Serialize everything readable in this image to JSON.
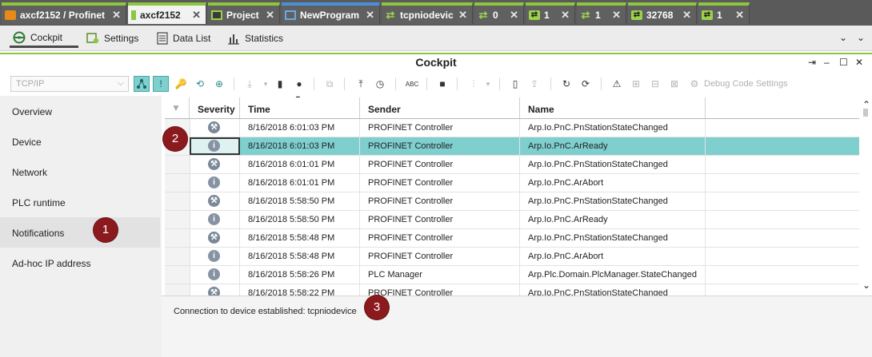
{
  "tabs": [
    {
      "label": "axcf2152 / Profinet",
      "icon": "device-orange-icon",
      "active": false
    },
    {
      "label": "axcf2152",
      "icon": "plc-green-icon",
      "active": true
    },
    {
      "label": "Project",
      "icon": "project-icon",
      "active": false
    },
    {
      "label": "NewProgram",
      "icon": "program-icon",
      "active": false
    },
    {
      "label": "tcpniodevice",
      "icon": "swap-arrows-icon",
      "active": false
    },
    {
      "label": "0",
      "icon": "swap-arrows-icon",
      "active": false
    },
    {
      "label": "1",
      "icon": "swap-box-icon",
      "active": false
    },
    {
      "label": "1",
      "icon": "swap-arrows-icon",
      "active": false
    },
    {
      "label": "32768",
      "icon": "swap-box-icon",
      "active": false
    },
    {
      "label": "1",
      "icon": "swap-box-icon",
      "active": false
    }
  ],
  "tab_close": "✕",
  "subtabs": [
    {
      "label": "Cockpit",
      "active": true
    },
    {
      "label": "Settings",
      "active": false
    },
    {
      "label": "Data List",
      "active": false
    },
    {
      "label": "Statistics",
      "active": false
    }
  ],
  "panel": {
    "title": "Cockpit"
  },
  "toolbar": {
    "connection_combo": "TCP/IP",
    "debug_label": "Debug Code Settings"
  },
  "nav": {
    "items": [
      "Overview",
      "Device",
      "Network",
      "PLC runtime",
      "Notifications",
      "Ad-hoc IP address"
    ],
    "selected": "Notifications"
  },
  "grid": {
    "columns": [
      "Severity",
      "Time",
      "Sender",
      "Name"
    ],
    "rows": [
      {
        "severity": "tool",
        "time": "8/16/2018 6:01:03 PM",
        "sender": "PROFINET Controller",
        "name": "Arp.Io.PnC.PnStationStateChanged"
      },
      {
        "severity": "info",
        "time": "8/16/2018 6:01:03 PM",
        "sender": "PROFINET Controller",
        "name": "Arp.Io.PnC.ArReady",
        "selected": true
      },
      {
        "severity": "tool",
        "time": "8/16/2018 6:01:01 PM",
        "sender": "PROFINET Controller",
        "name": "Arp.Io.PnC.PnStationStateChanged"
      },
      {
        "severity": "info",
        "time": "8/16/2018 6:01:01 PM",
        "sender": "PROFINET Controller",
        "name": "Arp.Io.PnC.ArAbort"
      },
      {
        "severity": "tool",
        "time": "8/16/2018 5:58:50 PM",
        "sender": "PROFINET Controller",
        "name": "Arp.Io.PnC.PnStationStateChanged"
      },
      {
        "severity": "info",
        "time": "8/16/2018 5:58:50 PM",
        "sender": "PROFINET Controller",
        "name": "Arp.Io.PnC.ArReady"
      },
      {
        "severity": "tool",
        "time": "8/16/2018 5:58:48 PM",
        "sender": "PROFINET Controller",
        "name": "Arp.Io.PnC.PnStationStateChanged"
      },
      {
        "severity": "info",
        "time": "8/16/2018 5:58:48 PM",
        "sender": "PROFINET Controller",
        "name": "Arp.Io.PnC.ArAbort"
      },
      {
        "severity": "info",
        "time": "8/16/2018 5:58:26 PM",
        "sender": "PLC Manager",
        "name": "Arp.Plc.Domain.PlcManager.StateChanged"
      },
      {
        "severity": "tool",
        "time": "8/16/2018 5:58:22 PM",
        "sender": "PROFINET Controller",
        "name": "Arp.Io.PnC.PnStationStateChanged"
      }
    ]
  },
  "status": {
    "message": "Connection to device established: tcpniodevice"
  },
  "callouts": [
    "1",
    "2",
    "3"
  ],
  "colors": {
    "accent_green": "#8dc63f",
    "selection_teal": "#7fcfcf",
    "callout": "#8b1a1f",
    "tabstrip": "#5a5a5a"
  }
}
